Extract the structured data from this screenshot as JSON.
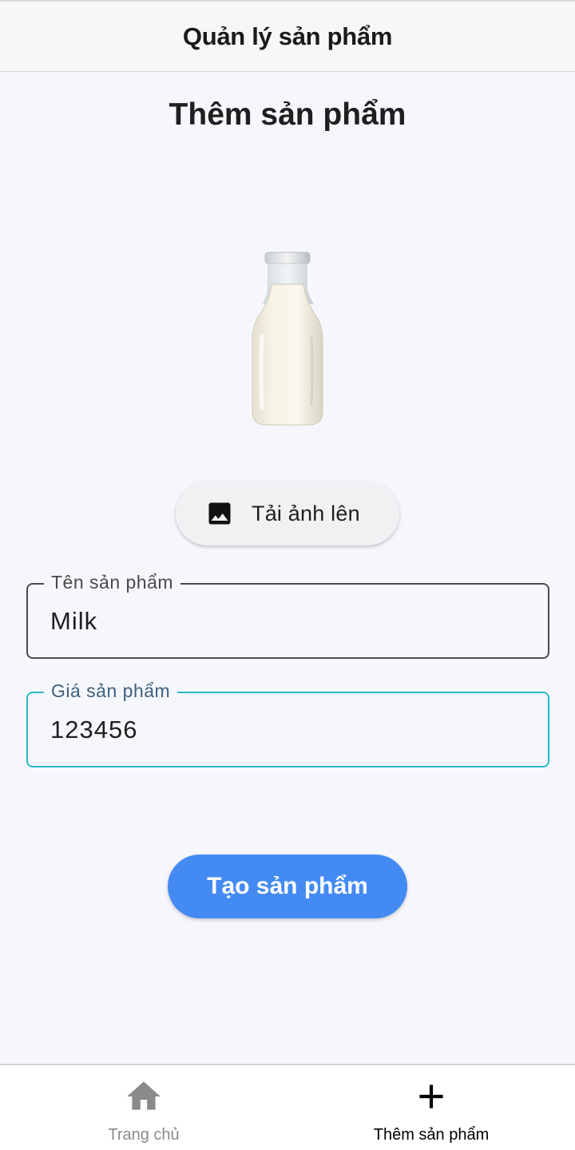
{
  "app_bar": {
    "title": "Quản lý sản phẩm"
  },
  "page": {
    "heading": "Thêm sản phẩm"
  },
  "product_image": {
    "icon": "milk-bottle-image"
  },
  "upload_button": {
    "label": "Tải ảnh lên",
    "icon": "image-icon"
  },
  "form": {
    "name_field": {
      "label": "Tên sản phẩm",
      "value": "Milk"
    },
    "price_field": {
      "label": "Giá sản phẩm",
      "value": "123456"
    }
  },
  "create_button": {
    "label": "Tạo sản phẩm",
    "color": "#448af3"
  },
  "bottom_nav": {
    "items": [
      {
        "label": "Trang chủ",
        "icon": "home-icon",
        "active": false
      },
      {
        "label": "Thêm sản phẩm",
        "icon": "plus-icon",
        "active": true
      }
    ]
  },
  "colors": {
    "accent": "#448af3",
    "focus_border": "#2bb7c6",
    "background": "#f6f7fc"
  }
}
